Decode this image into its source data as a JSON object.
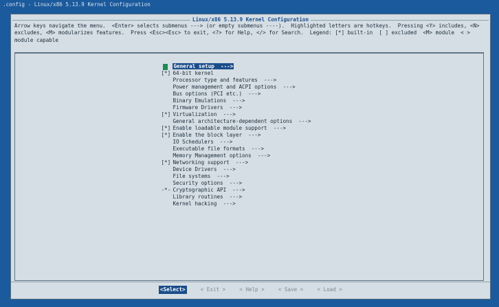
{
  "window": {
    "title": ".config - Linux/x86 5.13.9 Kernel Configuration"
  },
  "dialog": {
    "header": "Linux/x86 5.13.9 Kernel Configuration",
    "help_text": "Arrow keys navigate the menu.  <Enter> selects submenus ---> (or empty submenus ----).  Highlighted letters are hotkeys.  Pressing <Y> includes, <N> excludes, <M> modularizes features.  Press <Esc><Esc> to exit, <?> for Help, </> for Search.  Legend: [*] built-in  [ ] excluded  <M> module  < > module capable"
  },
  "menu": {
    "items": [
      {
        "marker": "",
        "label": "General setup  --->",
        "selected": true
      },
      {
        "marker": "[*]",
        "label": "64-bit kernel"
      },
      {
        "marker": "",
        "label": "Processor type and features  --->"
      },
      {
        "marker": "",
        "label": "Power management and ACPI options  --->"
      },
      {
        "marker": "",
        "label": "Bus options (PCI etc.)  --->"
      },
      {
        "marker": "",
        "label": "Binary Emulations  --->"
      },
      {
        "marker": "",
        "label": "Firmware Drivers  --->"
      },
      {
        "marker": "[*]",
        "label": "Virtualization  --->"
      },
      {
        "marker": "",
        "label": "General architecture-dependent options  --->"
      },
      {
        "marker": "[*]",
        "label": "Enable loadable module support  --->"
      },
      {
        "marker": "[*]",
        "label": "Enable the block layer  --->"
      },
      {
        "marker": "",
        "label": "IO Schedulers  --->"
      },
      {
        "marker": "",
        "label": "Executable file formats  --->"
      },
      {
        "marker": "",
        "label": "Memory Management options  --->"
      },
      {
        "marker": "[*]",
        "label": "Networking support  --->"
      },
      {
        "marker": "",
        "label": "Device Drivers  --->"
      },
      {
        "marker": "",
        "label": "File systems  --->"
      },
      {
        "marker": "",
        "label": "Security options  --->"
      },
      {
        "marker": "-*-",
        "label": "Cryptographic API  --->"
      },
      {
        "marker": "",
        "label": "Library routines  --->"
      },
      {
        "marker": "",
        "label": "Kernel hacking  --->"
      }
    ]
  },
  "buttons": {
    "select": "<Select>",
    "exit": "< Exit >",
    "help": "< Help >",
    "save": "< Save >",
    "load": "< Load >"
  },
  "colors": {
    "background": "#1b5a9c",
    "dialog": "#d5dee4",
    "highlight": "#1b4d8a",
    "cursor_block": "#1e8a58"
  }
}
